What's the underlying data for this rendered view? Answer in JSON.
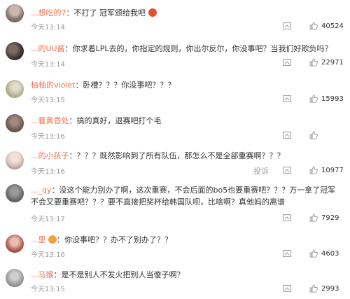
{
  "comments": [
    {
      "username": "...想吃的7",
      "text": "：不打了 冠军颁给我吧",
      "time": "今天13:14",
      "likes": "40524",
      "avatar_color": "#8a7a72",
      "emoji": "angry-face-icon"
    },
    {
      "username": "...的UU酱",
      "text": "：你求着LPL去的，你指定的规则，你出尔反尔，你没事吧？当我们好欺负吗？",
      "time": "今天13:14",
      "likes": "22971",
      "avatar_color": "#4a4040"
    },
    {
      "username": "柚柚的violet",
      "text": "：卧槽？？？你没事吧？？？",
      "time": "今天13:15",
      "likes": "15993",
      "avatar_color": "#b7b79a"
    },
    {
      "username": "...暮黄昏处",
      "text": "：搞的真好，退赛吧打个毛",
      "time": "今天13:16",
      "likes": "",
      "avatar_color": "#6d5a52"
    },
    {
      "username": "...的小孩子",
      "text": "：？？？既然影响到了所有队伍，那怎么不是全部重赛啊？？？",
      "time": "今天13:16",
      "likes": "10977",
      "report_label": "投诉",
      "avatar_color": "#d7c0b4"
    },
    {
      "username": "..._qy",
      "text": "：没这个能力别办了啊，这次重赛，不会后面的bo5也要重赛吧？？？万一拿了冠军不会又要重赛吧？？？要不直接把奖杯给韩国队呗，比啥啊？真他妈的离谱",
      "time": "今天13:17",
      "likes": "7929",
      "avatar_color": "#6a6a6a"
    },
    {
      "username": "...里",
      "text": "：你没事吧？？办不了别办了？？",
      "time": "今天13:16",
      "likes": "4603",
      "avatar_color": "#b05a52",
      "emoji": "crying-face-icon"
    },
    {
      "username": "...马猴",
      "text": "：是不是别人不发火把别人当傻子啊？",
      "time": "今天13:15",
      "likes": "2993",
      "avatar_color": "#9a9a9a"
    }
  ],
  "colors": {
    "username": "#eb7350",
    "text": "#333333",
    "meta": "#999999"
  }
}
